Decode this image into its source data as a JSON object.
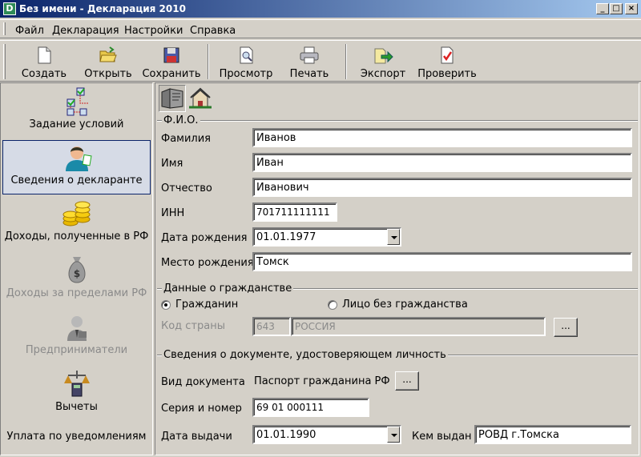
{
  "window": {
    "title": "Без имени - Декларация 2010",
    "app_icon_glyph": "D",
    "minimize_glyph": "_",
    "maximize_glyph": "□",
    "close_glyph": "×"
  },
  "menu": {
    "items": [
      "Файл",
      "Декларация",
      "Настройки",
      "Справка"
    ]
  },
  "toolbar": {
    "buttons": [
      {
        "label": "Создать",
        "icon": "new-document-icon"
      },
      {
        "label": "Открыть",
        "icon": "open-folder-icon"
      },
      {
        "label": "Сохранить",
        "icon": "floppy-disk-icon"
      },
      {
        "label": "Просмотр",
        "icon": "preview-icon"
      },
      {
        "label": "Печать",
        "icon": "printer-icon"
      },
      {
        "label": "Экспорт",
        "icon": "export-icon"
      },
      {
        "label": "Проверить",
        "icon": "check-document-icon"
      }
    ]
  },
  "sidebar": {
    "items": [
      {
        "label": "Задание условий",
        "icon": "flowchart-icon",
        "selected": false,
        "enabled": true
      },
      {
        "label": "Сведения о декларанте",
        "icon": "person-icon",
        "selected": true,
        "enabled": true
      },
      {
        "label": "Доходы, полученные в РФ",
        "icon": "coins-icon",
        "selected": false,
        "enabled": true
      },
      {
        "label": "Доходы за пределами РФ",
        "icon": "money-bag-icon",
        "selected": false,
        "enabled": false
      },
      {
        "label": "Предприниматели",
        "icon": "businessman-icon",
        "selected": false,
        "enabled": false
      },
      {
        "label": "Вычеты",
        "icon": "calculator-icon",
        "selected": false,
        "enabled": true
      },
      {
        "label": "Уплата по уведомлениям",
        "icon": "",
        "selected": false,
        "enabled": true
      }
    ]
  },
  "tabs": [
    {
      "icon": "id-card-icon",
      "active": true
    },
    {
      "icon": "house-icon",
      "active": false
    }
  ],
  "fio": {
    "legend": "Ф.И.О.",
    "surname_label": "Фамилия",
    "surname": "Иванов",
    "name_label": "Имя",
    "name": "Иван",
    "patronymic_label": "Отчество",
    "patronymic": "Иванович",
    "inn_label": "ИНН",
    "inn": "701711111111",
    "birth_date_label": "Дата рождения",
    "birth_date": "01.01.1977",
    "birth_place_label": "Место рождения",
    "birth_place": "Томск"
  },
  "citizenship": {
    "legend": "Данные о гражданстве",
    "citizen_label": "Гражданин",
    "stateless_label": "Лицо без гражданства",
    "selected": "citizen",
    "country_code_label": "Код страны",
    "country_code": "643",
    "country_name": "РОССИЯ",
    "browse_label": "..."
  },
  "document": {
    "legend": "Сведения о документе, удостоверяющем личность",
    "type_label": "Вид документа",
    "type": "Паспорт гражданина РФ",
    "browse_label": "...",
    "series_label": "Серия и номер",
    "series": "69 01 000111",
    "issue_date_label": "Дата выдачи",
    "issue_date": "01.01.1990",
    "issued_by_label": "Кем выдан",
    "issued_by": "РОВД г.Томска"
  }
}
